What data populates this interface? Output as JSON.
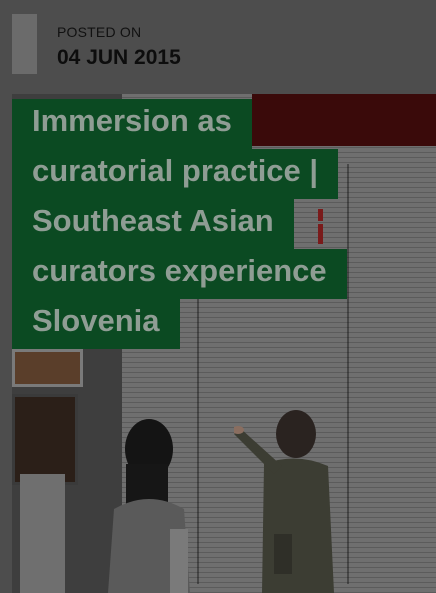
{
  "post": {
    "posted_label": "POSTED ON",
    "date": "04 JUN 2015"
  },
  "article": {
    "title_lines": [
      "Immersion as",
      "curatorial practice |",
      "Southeast Asian",
      "curators experience",
      "Slovenia"
    ]
  },
  "colors": {
    "overlay": "#4d4d4d",
    "title_bg": "#0b4a22",
    "title_text": "#8f9d94"
  },
  "icons": [
    "date-accent-bar"
  ]
}
